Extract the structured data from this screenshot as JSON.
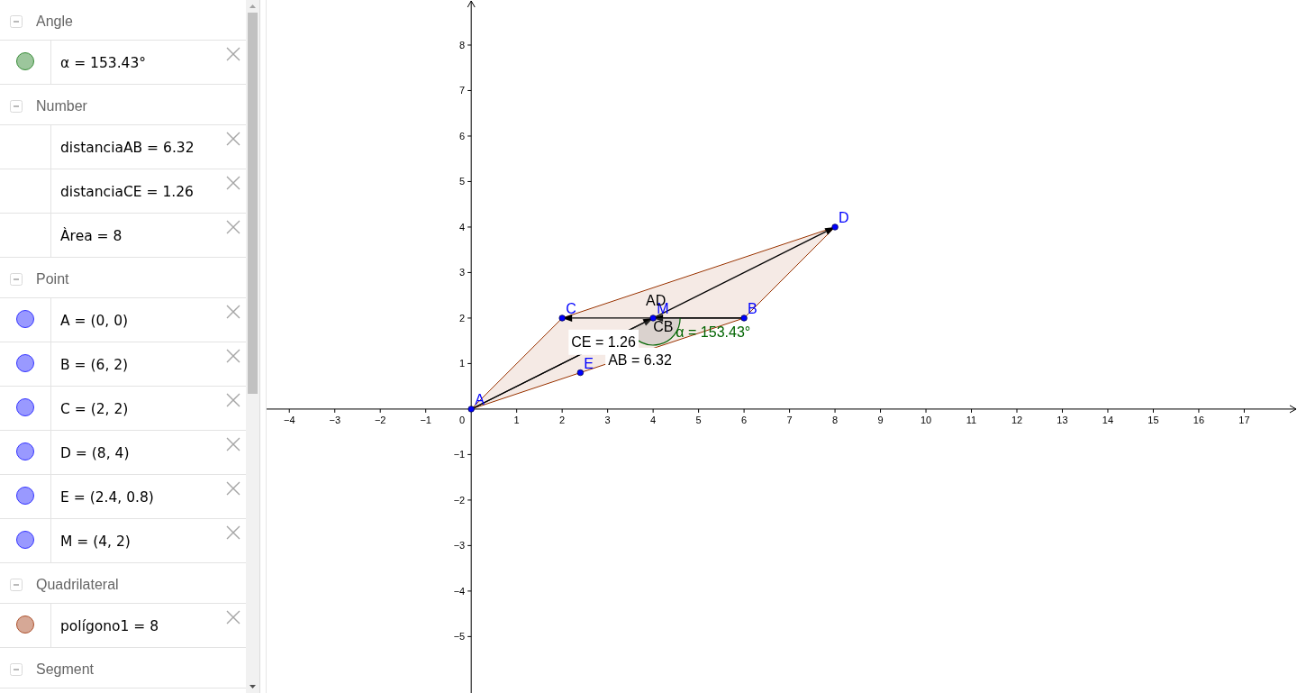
{
  "algebra_view": {
    "groups": [
      {
        "title": "Angle",
        "expanded": true,
        "items": [
          {
            "text": "α = 153.43°",
            "color": "#9cc69c"
          }
        ]
      },
      {
        "title": "Number",
        "expanded": true,
        "items": [
          {
            "text": "distanciaAB = 6.32"
          },
          {
            "text": "distanciaCE = 1.26"
          },
          {
            "text": "Àrea = 8"
          }
        ]
      },
      {
        "title": "Point",
        "expanded": true,
        "items": [
          {
            "text": "A = (0, 0)",
            "color": "#9999ff"
          },
          {
            "text": "B = (6, 2)",
            "color": "#9999ff"
          },
          {
            "text": "C = (2, 2)",
            "color": "#9999ff"
          },
          {
            "text": "D = (8, 4)",
            "color": "#9999ff"
          },
          {
            "text": "E = (2.4, 0.8)",
            "color": "#9999ff"
          },
          {
            "text": "M = (4, 2)",
            "color": "#9999ff"
          }
        ]
      },
      {
        "title": "Quadrilateral",
        "expanded": true,
        "items": [
          {
            "text": "polígono1 = 8",
            "color": "#d6a896"
          }
        ]
      },
      {
        "title": "Segment",
        "expanded": true
      }
    ]
  },
  "graphics_view": {
    "chart_data": {
      "type": "scatter",
      "xlim": [
        -4.5,
        18.16
      ],
      "ylim": [
        -6.24,
        8.99
      ],
      "xticks": [
        {
          "value": -4,
          "label": "−4"
        },
        {
          "value": -3,
          "label": "−3"
        },
        {
          "value": -2,
          "label": "−2"
        },
        {
          "value": -1,
          "label": "−1"
        },
        0,
        1,
        2,
        3,
        4,
        5,
        6,
        7,
        8,
        9,
        10,
        11,
        12,
        13,
        14,
        15,
        16,
        17
      ],
      "yticks": [
        {
          "value": -5,
          "label": "−5"
        },
        {
          "value": -4,
          "label": "−4"
        },
        {
          "value": -3,
          "label": "−3"
        },
        {
          "value": -2,
          "label": "−2"
        },
        {
          "value": -1,
          "label": "−1"
        },
        1,
        2,
        3,
        4,
        5,
        6,
        7,
        8
      ],
      "x": [
        8,
        2,
        4,
        6,
        2.4,
        0
      ],
      "series": [
        {
          "color": "#0000ff",
          "values": [
            4,
            2,
            2,
            2,
            0.8,
            0
          ]
        }
      ]
    },
    "point_labels": [
      "D",
      "C",
      "M",
      "B",
      "E",
      "A"
    ],
    "vector_labels": [
      "AD",
      "CB"
    ],
    "angle_label": "α = 153.43°",
    "measurements": [
      {
        "text": "CE = 1.26",
        "background": true
      },
      {
        "text": "AB = 6.32",
        "background": true
      }
    ]
  }
}
